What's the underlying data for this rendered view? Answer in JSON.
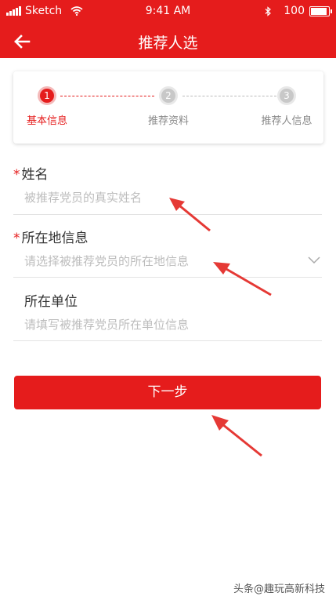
{
  "status_bar": {
    "carrier": "Sketch",
    "time": "9:41 AM",
    "battery": "100",
    "battery_level": 1.0
  },
  "nav": {
    "title": "推荐人选"
  },
  "steps": [
    {
      "number": "1",
      "label": "基本信息",
      "active": true
    },
    {
      "number": "2",
      "label": "推荐资料",
      "active": false
    },
    {
      "number": "3",
      "label": "推荐人信息",
      "active": false
    }
  ],
  "form": {
    "required_mark": "*",
    "name": {
      "label": "姓名",
      "placeholder": "被推荐党员的真实姓名"
    },
    "location": {
      "label": "所在地信息",
      "placeholder": "请选择被推荐党员的所在地信息"
    },
    "unit": {
      "label": "所在单位",
      "placeholder": "请填写被推荐党员所在单位信息"
    }
  },
  "buttons": {
    "next": "下一步"
  },
  "watermark": {
    "text": "头条@趣玩高新科技"
  },
  "colors": {
    "accent": "#e51c1c",
    "annotation_arrow": "#e53935"
  }
}
